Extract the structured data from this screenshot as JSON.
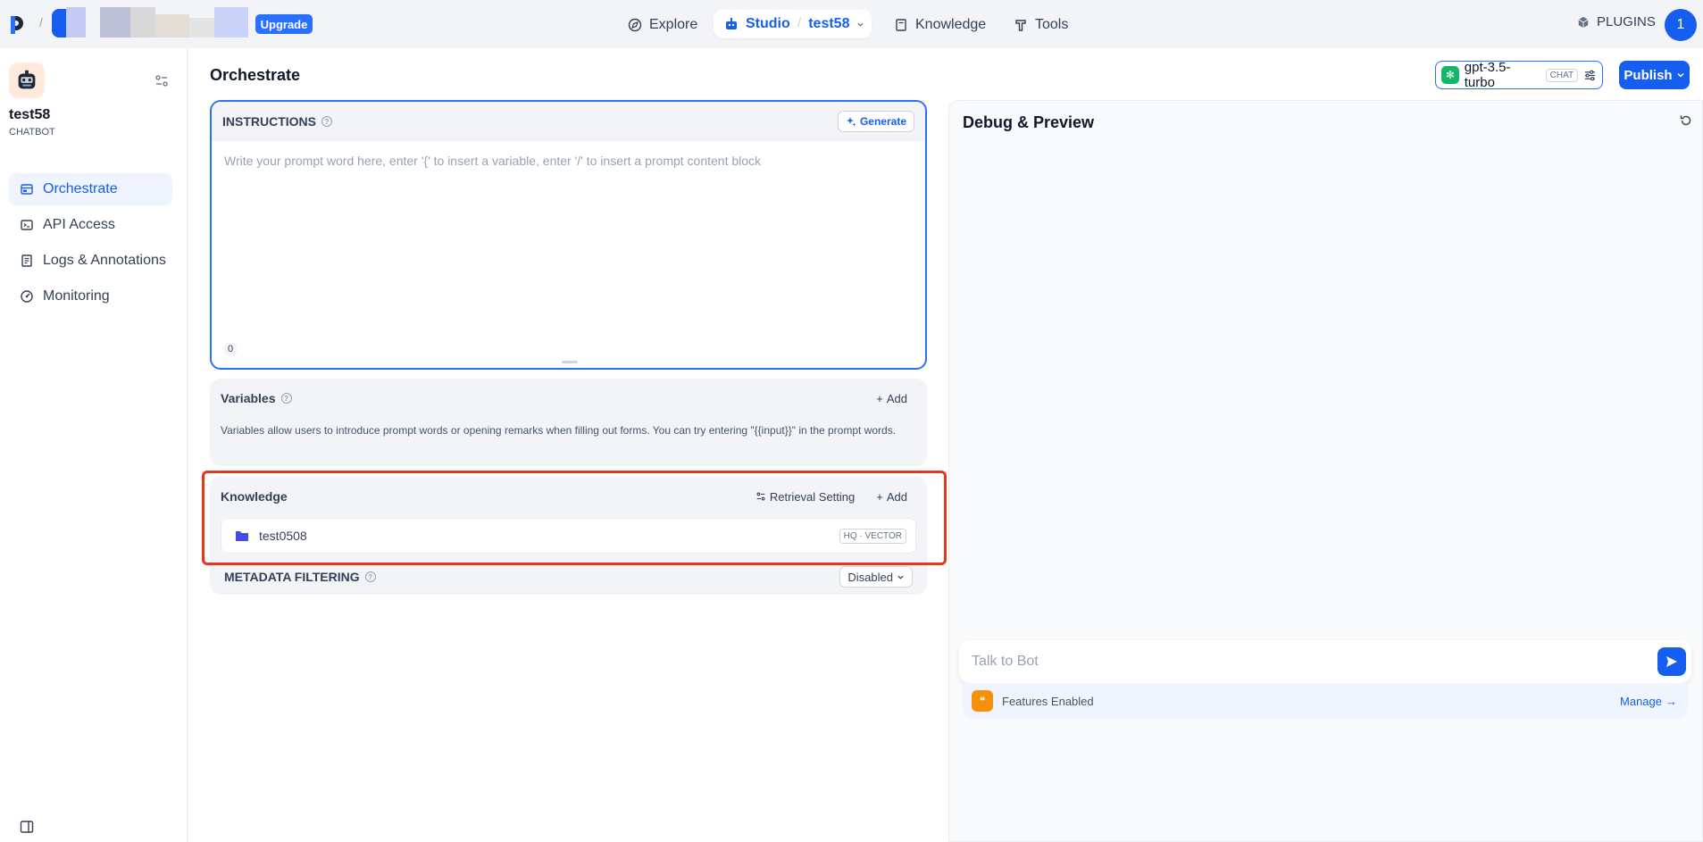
{
  "topbar": {
    "upgrade_label": "Upgrade",
    "nav": {
      "explore": "Explore",
      "studio": "Studio",
      "app": "test58",
      "knowledge": "Knowledge",
      "tools": "Tools"
    },
    "plugins_label": "PLUGINS",
    "avatar_initial": "1"
  },
  "sidebar": {
    "app_name": "test58",
    "app_type": "CHATBOT",
    "items": [
      {
        "label": "Orchestrate",
        "icon": "orchestrate-icon",
        "active": true
      },
      {
        "label": "API Access",
        "icon": "terminal-icon",
        "active": false
      },
      {
        "label": "Logs & Annotations",
        "icon": "logs-icon",
        "active": false
      },
      {
        "label": "Monitoring",
        "icon": "monitoring-icon",
        "active": false
      }
    ]
  },
  "header": {
    "title": "Orchestrate",
    "model_name": "gpt-3.5-turbo",
    "model_tag": "CHAT",
    "publish_label": "Publish"
  },
  "instructions": {
    "title": "INSTRUCTIONS",
    "generate_label": "Generate",
    "placeholder": "Write your prompt word here, enter '{' to insert a variable, enter '/' to insert a prompt content block",
    "char_count": "0"
  },
  "variables": {
    "title": "Variables",
    "add_label": "Add",
    "description": "Variables allow users to introduce prompt words or opening remarks when filling out forms. You can try entering \"{{input}}\" in the prompt words."
  },
  "knowledge": {
    "title": "Knowledge",
    "retrieval_label": "Retrieval Setting",
    "add_label": "Add",
    "items": [
      {
        "name": "test0508",
        "badge": "HQ · VECTOR"
      }
    ]
  },
  "metadata": {
    "title": "METADATA FILTERING",
    "value": "Disabled"
  },
  "debug": {
    "title": "Debug & Preview",
    "input_placeholder": "Talk to Bot",
    "features_label": "Features Enabled",
    "manage_label": "Manage"
  },
  "colors": {
    "accent": "#155eef",
    "highlight": "#e3381f"
  }
}
